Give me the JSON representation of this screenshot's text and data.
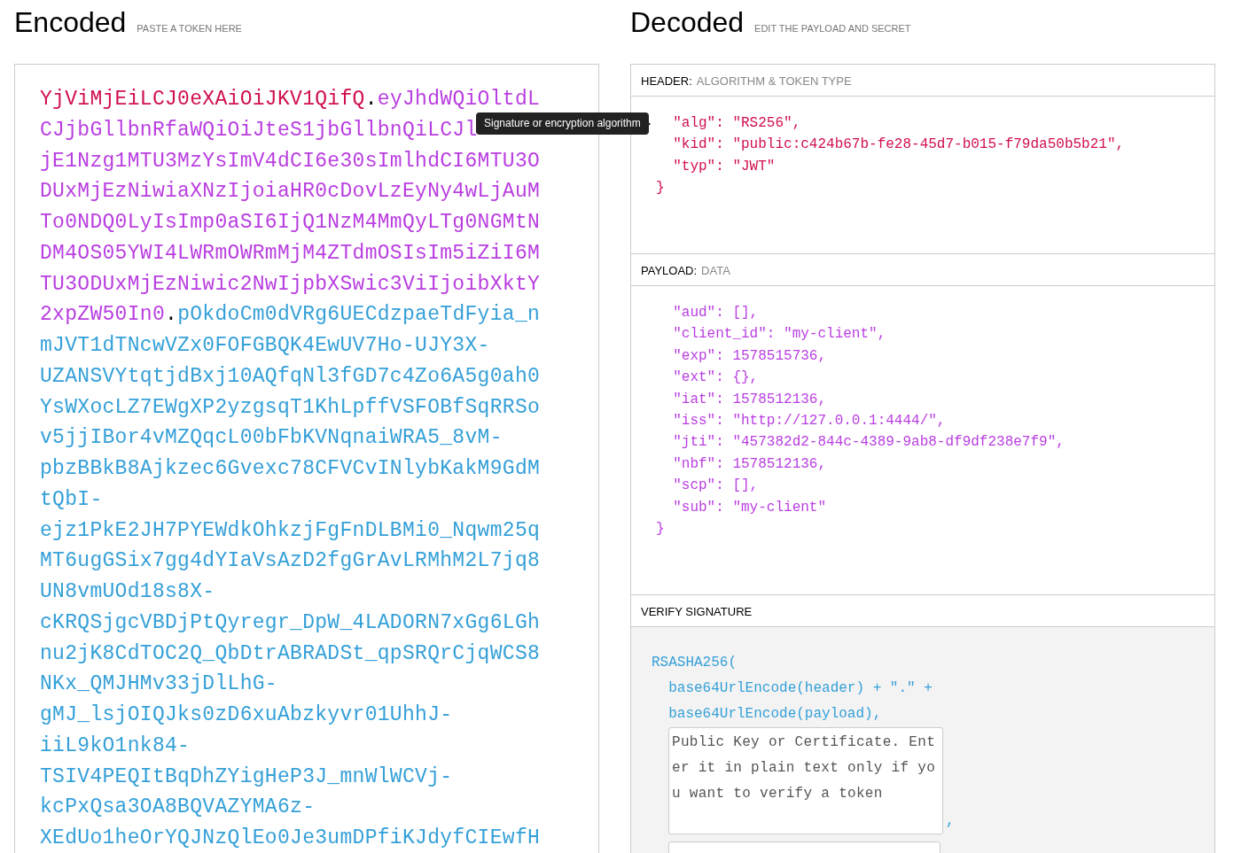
{
  "encoded": {
    "title": "Encoded",
    "subtitle": "PASTE A TOKEN HERE",
    "tooltip": "Signature or encryption algorithm",
    "lines": [
      [
        {
          "kind": "header",
          "text": "YjViMjEiLCJ0eXAiOiJKV1QifQ"
        },
        {
          "kind": "dot",
          "text": "."
        },
        {
          "kind": "payload",
          "text": "eyJhdWQiOltdL"
        }
      ],
      [
        {
          "kind": "payload",
          "text": "CJjbGllbnRfaWQiOiJteS1jbGllbnQiLCJl"
        }
      ],
      [
        {
          "kind": "payload",
          "text": "jE1Nzg1MTU3MzYsImV4dCI6e30sImlhdCI6MTU3O"
        }
      ],
      [
        {
          "kind": "payload",
          "text": "DUxMjEzNiwiaXNzIjoiaHR0cDovLzEyNy4wLjAuM"
        }
      ],
      [
        {
          "kind": "payload",
          "text": "To0NDQ0LyIsImp0aSI6IjQ1NzM4MmQyLTg0NGMtN"
        }
      ],
      [
        {
          "kind": "payload",
          "text": "DM4OS05YWI4LWRmOWRmMjM4ZTdmOSIsIm5iZiI6M"
        }
      ],
      [
        {
          "kind": "payload",
          "text": "TU3ODUxMjEzNiwic2NwIjpbXSwic3ViIjoibXktY"
        }
      ],
      [
        {
          "kind": "payload",
          "text": "2xpZW50In0"
        },
        {
          "kind": "dot",
          "text": "."
        },
        {
          "kind": "signature",
          "text": "pOkdoCm0dVRg6UECdzpaeTdFyia_n"
        }
      ],
      [
        {
          "kind": "signature",
          "text": "mJVT1dTNcwVZx0FOFGBQK4EwUV7Ho-UJY3X-"
        }
      ],
      [
        {
          "kind": "signature",
          "text": "UZANSVYtqtjdBxj10AQfqNl3fGD7c4Zo6A5g0ah0"
        }
      ],
      [
        {
          "kind": "signature",
          "text": "YsWXocLZ7EWgXP2yzgsqT1KhLpffVSFOBfSqRRSo"
        }
      ],
      [
        {
          "kind": "signature",
          "text": "v5jjIBor4vMZQqcL00bFbKVNqnaiWRA5_8vM-"
        }
      ],
      [
        {
          "kind": "signature",
          "text": "pbzBBkB8Ajkzec6Gvexc78CFVCvINlybKakM9GdM"
        }
      ],
      [
        {
          "kind": "signature",
          "text": "tQbI-"
        }
      ],
      [
        {
          "kind": "signature",
          "text": "ejz1PkE2JH7PYEWdkOhkzjFgFnDLBMi0_Nqwm25q"
        }
      ],
      [
        {
          "kind": "signature",
          "text": "MT6ugGSix7gg4dYIaVsAzD2fgGrAvLRMhM2L7jq8"
        }
      ],
      [
        {
          "kind": "signature",
          "text": "UN8vmUOd18s8X-"
        }
      ],
      [
        {
          "kind": "signature",
          "text": "cKRQSjgcVBDjPtQyregr_DpW_4LADORN7xGg6LGh"
        }
      ],
      [
        {
          "kind": "signature",
          "text": "nu2jK8CdTOC2Q_QbDtrABRADSt_qpSRQrCjqWCS8"
        }
      ],
      [
        {
          "kind": "signature",
          "text": "NKx_QMJHMv33jDlLhG-"
        }
      ],
      [
        {
          "kind": "signature",
          "text": "gMJ_lsjOIQJks0zD6xuAbzkyvr01UhhJ-"
        }
      ],
      [
        {
          "kind": "signature",
          "text": "iiL9kO1nk84-"
        }
      ],
      [
        {
          "kind": "signature",
          "text": "TSIV4PEQItBqDhZYigHeP3J_mnWlWCVj-"
        }
      ],
      [
        {
          "kind": "signature",
          "text": "kcPxQsa3OA8BQVAZYMA6z-"
        }
      ],
      [
        {
          "kind": "signature",
          "text": "XEdUo1heOrYQJNzQlEo0Je3umDPfiKJdyfCIEwfH"
        }
      ]
    ]
  },
  "decoded": {
    "title": "Decoded",
    "subtitle": "EDIT THE PAYLOAD AND SECRET",
    "sections": [
      {
        "kind": "header",
        "label": "HEADER:",
        "sublabel": "ALGORITHM & TOKEN TYPE",
        "lines": [
          "  \"alg\": \"RS256\",",
          "  \"kid\": \"public:c424b67b-fe28-45d7-b015-f79da50b5b21\",",
          "  \"typ\": \"JWT\"",
          "}"
        ]
      },
      {
        "kind": "payload",
        "label": "PAYLOAD:",
        "sublabel": "DATA",
        "lines": [
          "  \"aud\": [],",
          "  \"client_id\": \"my-client\",",
          "  \"exp\": 1578515736,",
          "  \"ext\": {},",
          "  \"iat\": 1578512136,",
          "  \"iss\": \"http://127.0.0.1:4444/\",",
          "  \"jti\": \"457382d2-844c-4389-9ab8-df9df238e7f9\",",
          "  \"nbf\": 1578512136,",
          "  \"scp\": [],",
          "  \"sub\": \"my-client\"",
          "}"
        ]
      },
      {
        "kind": "verify",
        "label": "VERIFY SIGNATURE",
        "code": [
          "RSASHA256(",
          "  base64UrlEncode(header) + \".\" +",
          "  base64UrlEncode(payload),"
        ],
        "placeholder": "Public Key or Certificate. Enter it in plain text only if you want to verify a token",
        "separator": ","
      }
    ]
  }
}
